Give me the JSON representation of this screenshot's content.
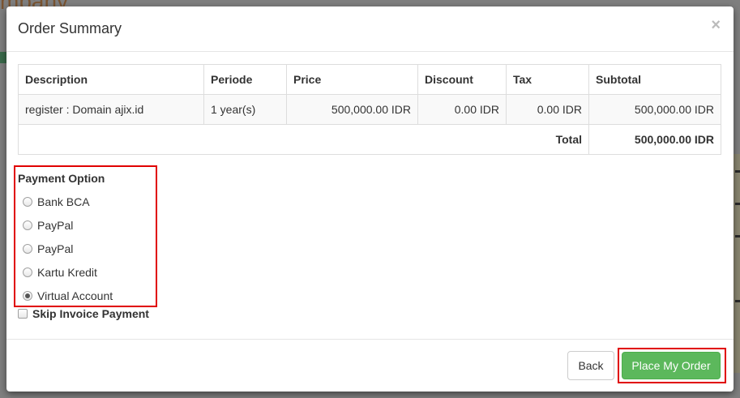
{
  "background": {
    "brand_text": "mpany"
  },
  "modal": {
    "title": "Order Summary",
    "close_label": "×"
  },
  "table": {
    "headers": [
      "Description",
      "Periode",
      "Price",
      "Discount",
      "Tax",
      "Subtotal"
    ],
    "row": {
      "description": "register : Domain ajix.id",
      "periode": "1 year(s)",
      "price": "500,000.00 IDR",
      "discount": "0.00 IDR",
      "tax": "0.00 IDR",
      "subtotal": "500,000.00 IDR"
    },
    "total_label": "Total",
    "total_value": "500,000.00 IDR"
  },
  "payment": {
    "title": "Payment Option",
    "options": [
      "Bank BCA",
      "PayPal",
      "PayPal",
      "Kartu Kredit",
      "Virtual Account"
    ],
    "selected": "Virtual Account"
  },
  "skip_invoice_label": "Skip Invoice Payment",
  "footer": {
    "back_label": "Back",
    "place_order_label": "Place My Order"
  },
  "colors": {
    "primary_button": "#5cb85c",
    "highlight": "#e00000"
  }
}
